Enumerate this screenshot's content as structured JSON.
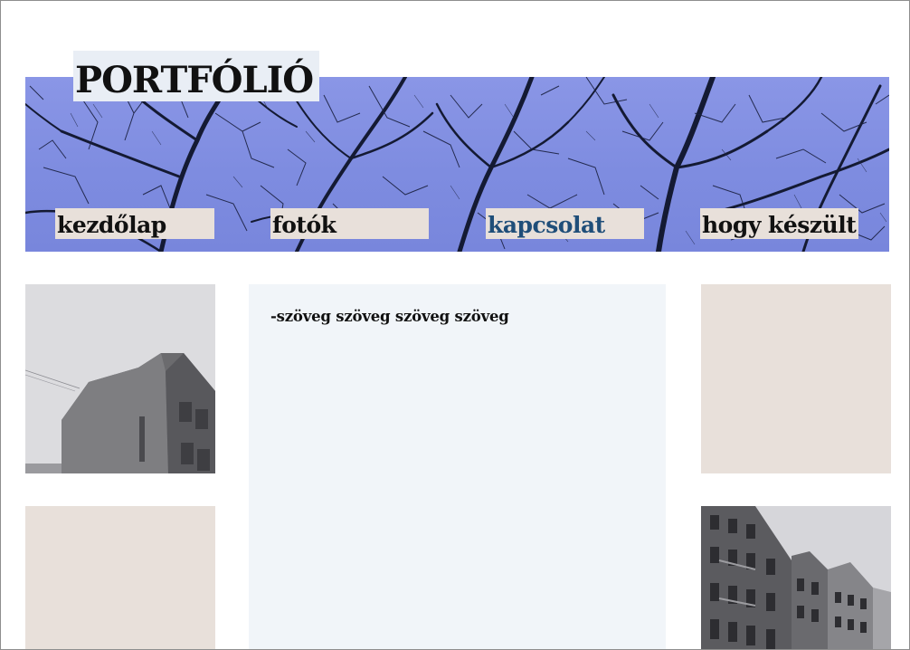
{
  "header": {
    "title": "PORTFÓLIÓ"
  },
  "nav": {
    "items": [
      {
        "label": "kezdőlap"
      },
      {
        "label": "fotók"
      },
      {
        "label": "kapcsolat",
        "active": true
      },
      {
        "label": "hogy készült"
      }
    ]
  },
  "main": {
    "text": "-szöveg szöveg szöveg szöveg"
  },
  "colors": {
    "banner_sky": "#8a96e6",
    "title_box": "#e9eef5",
    "nav_bg": "#e8e0da",
    "nav_active": "#1f4e79",
    "center_panel": "#f1f5f9",
    "tile": "#e8e0da"
  }
}
